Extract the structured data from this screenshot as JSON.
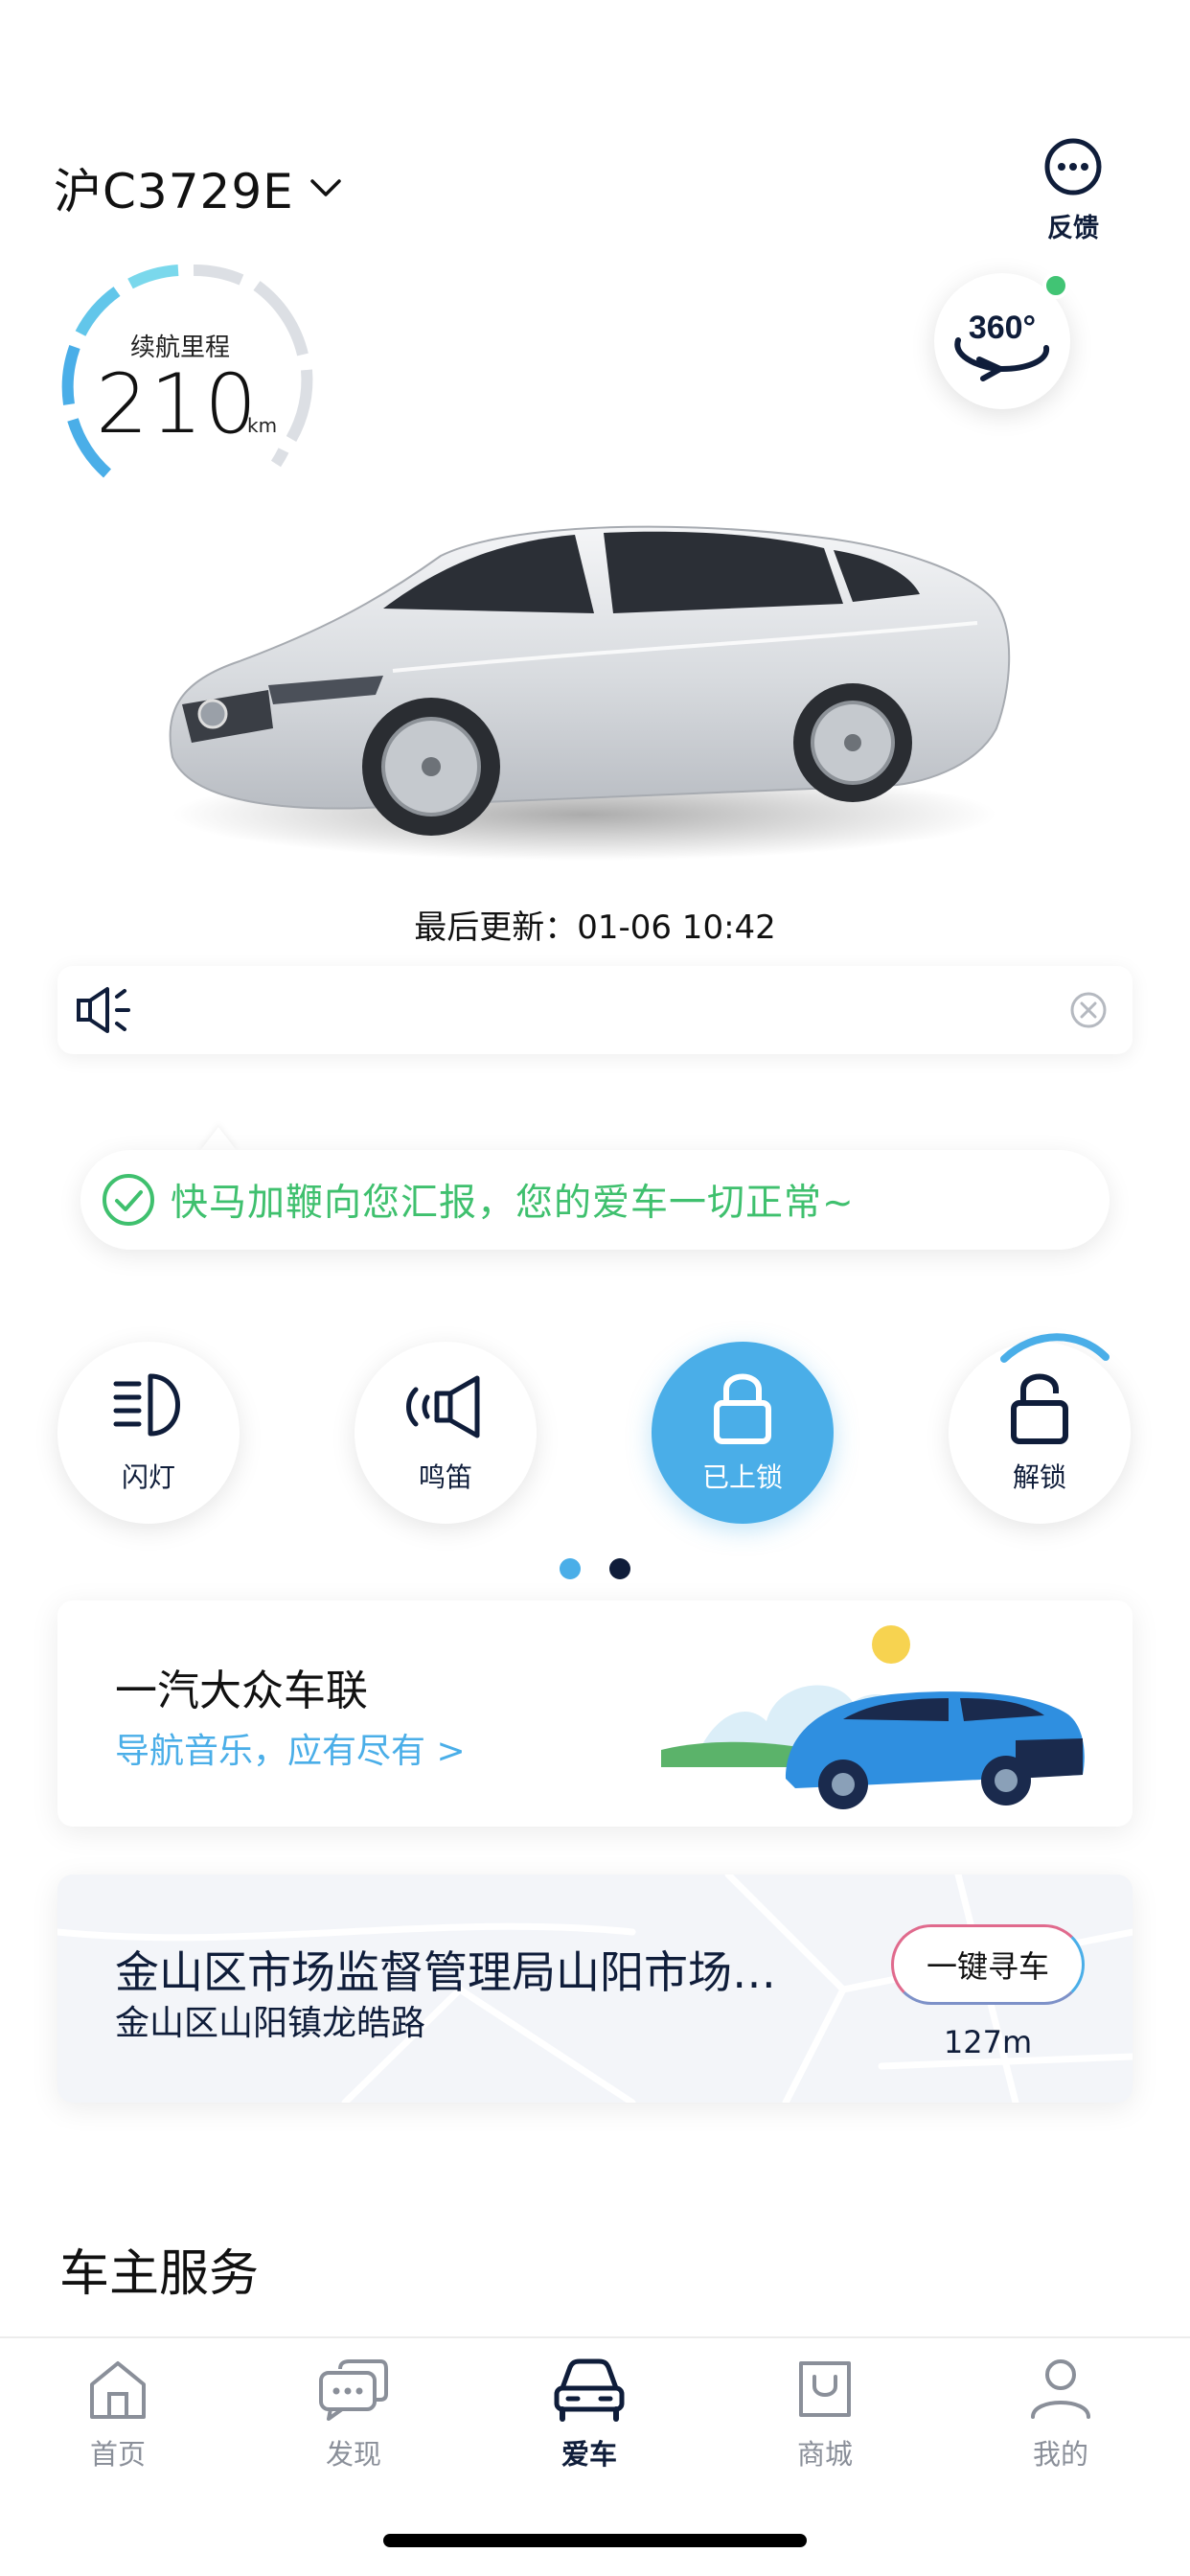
{
  "header": {
    "plate": "沪C3729E",
    "feedback_label": "反馈",
    "view360_label": "360°"
  },
  "range": {
    "label": "续航里程",
    "value": "210",
    "unit": "km"
  },
  "last_update": "最后更新：01-06 10:42",
  "status_message": "快马加鞭向您汇报，您的爱车一切正常~",
  "controls": [
    {
      "label": "闪灯"
    },
    {
      "label": "鸣笛"
    },
    {
      "label": "已上锁"
    },
    {
      "label": "解锁"
    }
  ],
  "carnet": {
    "title": "一汽大众车联",
    "subtitle": "导航音乐，应有尽有 >"
  },
  "location": {
    "title": "金山区市场监督管理局山阳市场…",
    "address": "金山区山阳镇龙皓路",
    "find_button": "一键寻车",
    "distance": "127m"
  },
  "owner_services_title": "车主服务",
  "tabs": [
    {
      "label": "首页",
      "icon": "home-icon"
    },
    {
      "label": "发现",
      "icon": "chat-icon"
    },
    {
      "label": "爱车",
      "icon": "car-icon"
    },
    {
      "label": "商城",
      "icon": "shop-bag-icon"
    },
    {
      "label": "我的",
      "icon": "profile-icon"
    }
  ],
  "colors": {
    "accent_blue": "#4aaee8",
    "navy": "#0f1d3a",
    "success_green": "#3fc06e",
    "online_dot": "#41c474"
  }
}
